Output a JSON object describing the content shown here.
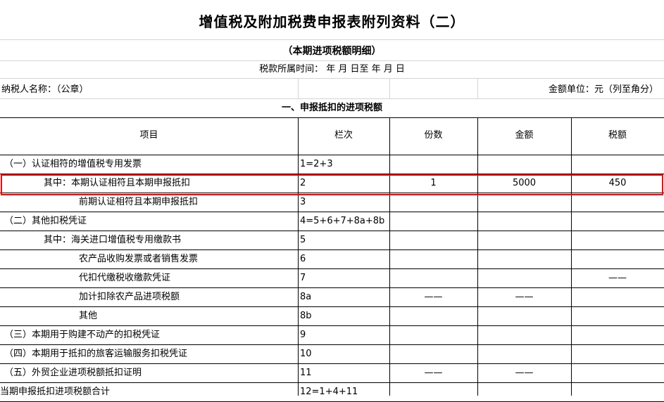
{
  "form": {
    "title": "增值税及附加税费申报表附列资料（二）",
    "subtitle": "（本期进项税额明细）",
    "period": "税款所属时间：  年      月    日至      年      月      日",
    "taxpayer_label": "纳税人名称：（公章）",
    "unit_label": "金额单位：元（列至角分）",
    "section_title": "一、申报抵扣的进项税额"
  },
  "table": {
    "headers": [
      "项目",
      "栏次",
      "份数",
      "金额",
      "税额"
    ],
    "rows": [
      {
        "item": "（一）认证相符的增值税专用发票",
        "line": "1=2+3",
        "count": "",
        "amount": "",
        "tax": ""
      },
      {
        "item": "其中：本期认证相符且本期申报抵扣",
        "line": "2",
        "count": "1",
        "amount": "5000",
        "tax": "450"
      },
      {
        "item": "前期认证相符且本期申报抵扣",
        "line": "3",
        "count": "",
        "amount": "",
        "tax": ""
      },
      {
        "item": "（二）其他扣税凭证",
        "line": "4=5+6+7+8a+8b",
        "count": "",
        "amount": "",
        "tax": ""
      },
      {
        "item": "其中：海关进口增值税专用缴款书",
        "line": "5",
        "count": "",
        "amount": "",
        "tax": ""
      },
      {
        "item": "农产品收购发票或者销售发票",
        "line": "6",
        "count": "",
        "amount": "",
        "tax": ""
      },
      {
        "item": "代扣代缴税收缴款凭证",
        "line": "7",
        "count": "",
        "amount": "",
        "tax": "——"
      },
      {
        "item": "加计扣除农产品进项税额",
        "line": "8a",
        "count": "——",
        "amount": "——",
        "tax": ""
      },
      {
        "item": "其他",
        "line": "8b",
        "count": "",
        "amount": "",
        "tax": ""
      },
      {
        "item": "（三）本期用于购建不动产的扣税凭证",
        "line": "9",
        "count": "",
        "amount": "",
        "tax": ""
      },
      {
        "item": "（四）本期用于抵扣的旅客运输服务扣税凭证",
        "line": "10",
        "count": "",
        "amount": "",
        "tax": ""
      },
      {
        "item": "（五）外贸企业进项税额抵扣证明",
        "line": "11",
        "count": "——",
        "amount": "——",
        "tax": ""
      },
      {
        "item": "当期申报抵扣进项税额合计",
        "line": "12=1+4+11",
        "count": "",
        "amount": "",
        "tax": ""
      }
    ]
  },
  "colors": {
    "grid": "#d4d4d4",
    "border": "#000000",
    "highlight": "#ee0000"
  }
}
